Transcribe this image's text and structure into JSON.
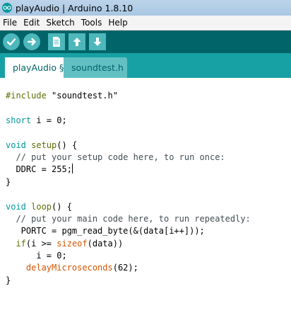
{
  "window": {
    "title": "playAudio | Arduino 1.8.10",
    "background_text": "playAudio | Arduino 1.8.10"
  },
  "menu": {
    "items": [
      "File",
      "Edit",
      "Sketch",
      "Tools",
      "Help"
    ]
  },
  "toolbar": {
    "buttons": [
      "verify-icon",
      "upload-icon",
      "new-icon",
      "open-icon",
      "save-icon"
    ]
  },
  "tabs": [
    {
      "label": "playAudio §",
      "active": true
    },
    {
      "label": "soundtest.h",
      "active": false
    }
  ],
  "code": {
    "include_kw": "#include",
    "include_file": "\"soundtest.h\"",
    "l3_type": "short",
    "l3_rest": " i = 0;",
    "l5_type": "void",
    "l5_name": " setup",
    "l5_rest": "() {",
    "l6": "  // put your setup code here, to run once:",
    "l7": "  DDRC = 255;",
    "l8": "}",
    "l10_type": "void",
    "l10_name": " loop",
    "l10_rest": "() {",
    "l11": "  // put your main code here, to run repeatedly:",
    "l12_pre": "   PORTC = ",
    "l12_fn": "pgm_read_byte",
    "l12_post": "(&(data[i++]));",
    "l13_pre": "  ",
    "l13_kw": "if",
    "l13_mid": "(i >= ",
    "l13_fn": "sizeof",
    "l13_post": "(data))",
    "l14": "      i = 0;",
    "l15_pre": "    ",
    "l15_fn": "delayMicroseconds",
    "l15_post": "(62);",
    "l16": "}"
  },
  "colors": {
    "toolbar": "#006468",
    "tabbar": "#17a1a5",
    "keyword": "#00979c",
    "function": "#d35400"
  }
}
